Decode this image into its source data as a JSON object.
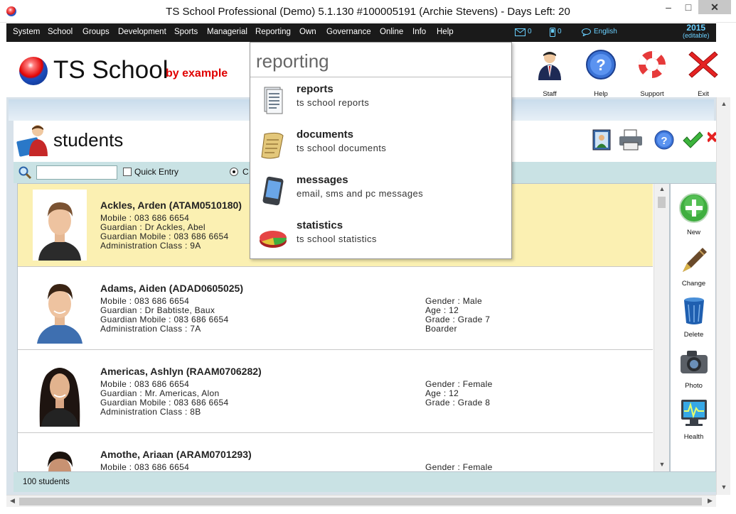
{
  "window": {
    "title": "TS School Professional (Demo) 5.1.130 #100005191 (Archie Stevens) - Days Left: 20",
    "minimize": "–",
    "maximize": "□",
    "close": "✕"
  },
  "menu": {
    "items": [
      "System",
      "School",
      "Groups",
      "Development",
      "Sports",
      "Managerial",
      "Reporting",
      "Own",
      "Governance",
      "Online",
      "Info",
      "Help"
    ],
    "mail_count": "0",
    "sms_count": "0",
    "language": "English",
    "year": "2015",
    "year_note": "(editable)"
  },
  "header": {
    "logo_text": "TS School",
    "logo_sub": "by example",
    "buttons": [
      {
        "label": "Staff",
        "icon": "staff-icon"
      },
      {
        "label": "Help",
        "icon": "help-icon"
      },
      {
        "label": "Support",
        "icon": "lifebuoy-icon"
      },
      {
        "label": "Exit",
        "icon": "exit-icon"
      }
    ]
  },
  "students": {
    "title": "students",
    "search": {
      "value": "",
      "quick_entry_label": "Quick Entry",
      "radio_label": "C"
    },
    "rows": [
      {
        "name": "Ackles, Arden (ATAM0510180)",
        "mobile": "Mobile : 083 686 6654",
        "guardian": "Guardian : Dr Ackles, Abel",
        "guardian_mobile": "Guardian Mobile : 083 686 6654",
        "admin_class": "Administration Class : 9A",
        "gender": "",
        "age": "",
        "grade": "",
        "extra": ""
      },
      {
        "name": "Adams, Aiden (ADAD0605025)",
        "mobile": "Mobile : 083 686 6654",
        "guardian": "Guardian : Dr Babtiste, Baux",
        "guardian_mobile": "Guardian Mobile : 083 686 6654",
        "admin_class": "Administration Class : 7A",
        "gender": "Gender : Male",
        "age": "Age : 12",
        "grade": "Grade : Grade 7",
        "extra": "Boarder"
      },
      {
        "name": "Americas, Ashlyn (RAAM0706282)",
        "mobile": "Mobile : 083 686 6654",
        "guardian": "Guardian : Mr. Americas, Alon",
        "guardian_mobile": "Guardian Mobile : 083 686 6654",
        "admin_class": "Administration Class : 8B",
        "gender": "Gender : Female",
        "age": "Age : 12",
        "grade": "Grade : Grade 8",
        "extra": ""
      },
      {
        "name": "Amothe, Ariaan (ARAM0701293)",
        "mobile": "Mobile : 083 686 6654",
        "guardian": "",
        "guardian_mobile": "",
        "admin_class": "",
        "gender": "Gender : Female",
        "age": "",
        "grade": "",
        "extra": ""
      }
    ],
    "side_buttons": [
      {
        "label": "New"
      },
      {
        "label": "Change"
      },
      {
        "label": "Delete"
      },
      {
        "label": "Photo"
      },
      {
        "label": "Health"
      }
    ],
    "status": "100 students"
  },
  "dropdown": {
    "title": "reporting",
    "items": [
      {
        "label": "reports",
        "sub": "ts school reports"
      },
      {
        "label": "documents",
        "sub": "ts school documents"
      },
      {
        "label": "messages",
        "sub": "email, sms and pc messages"
      },
      {
        "label": "statistics",
        "sub": "ts school statistics"
      }
    ]
  }
}
